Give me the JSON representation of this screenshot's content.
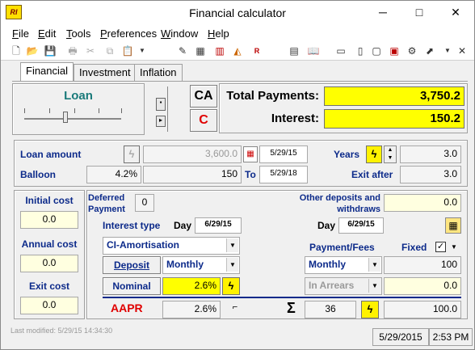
{
  "window": {
    "title": "Financial calculator",
    "icon_text": "RI",
    "controls": {
      "minimize": "─",
      "maximize": "□",
      "close": "✕"
    }
  },
  "menu": [
    "File",
    "Edit",
    "Tools",
    "Preferences",
    "Window",
    "Help"
  ],
  "menu_mnemonics": [
    "F",
    "E",
    "T",
    "P",
    "W",
    "H"
  ],
  "tabs": [
    {
      "label": "Financial",
      "active": true
    },
    {
      "label": "Investment",
      "active": false
    },
    {
      "label": "Inflation",
      "active": false
    }
  ],
  "loan_panel": {
    "label": "Loan"
  },
  "ca_button": "CA",
  "c_button": "C",
  "totals": {
    "total_payments_label": "Total Payments:",
    "total_payments_value": "3,750.2",
    "interest_label": "Interest:",
    "interest_value": "150.2"
  },
  "loan": {
    "amount_label": "Loan amount",
    "amount_value": "3,600.0",
    "start_date": "5/29/15",
    "years_label": "Years",
    "years_value": "3.0",
    "balloon_label": "Balloon",
    "balloon_percent": "4.2%",
    "balloon_value": "150",
    "to_label": "To",
    "end_date": "5/29/18",
    "exit_after_label": "Exit after",
    "exit_after_value": "3.0"
  },
  "costs": {
    "initial_label": "Initial cost",
    "initial_value": "0.0",
    "annual_label": "Annual cost",
    "annual_value": "0.0",
    "exit_label": "Exit cost",
    "exit_value": "0.0"
  },
  "deferred": {
    "label": "Deferred Payment",
    "value": "0",
    "other_label": "Other deposits and withdraws",
    "other_value": "0.0"
  },
  "interest_type": {
    "label": "Interest type",
    "day_label": "Day",
    "day_value": "6/29/15",
    "day2_label": "Day",
    "day2_value": "6/29/15",
    "method": "CI-Amortisation"
  },
  "deposit": {
    "button": "Deposit",
    "frequency": "Monthly"
  },
  "nominal": {
    "button": "Nominal",
    "value": "2.6%"
  },
  "payment_fees": {
    "label": "Payment/Fees",
    "fixed_label": "Fixed",
    "fixed_checked": true,
    "frequency": "Monthly",
    "amount": "100",
    "timing": "In Arrears",
    "timing_value": "0.0"
  },
  "aapr": {
    "label": "AAPR",
    "value": "2.6%"
  },
  "sum": {
    "symbol": "Σ",
    "count": "36",
    "total": "100.0"
  },
  "status": {
    "last_modified": "Last modified: 5/29/15 14:34:30",
    "date": "5/29/2015",
    "time": "2:53 PM"
  },
  "colors": {
    "yellow": "#ffff00",
    "label_blue": "#0c2a8a",
    "aapr_red": "#e00000",
    "c_red": "#e00000"
  }
}
